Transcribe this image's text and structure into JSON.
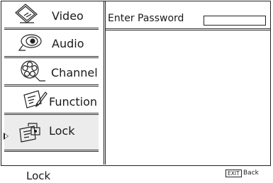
{
  "menu": {
    "items": [
      {
        "label": "Video",
        "icon": "video-icon"
      },
      {
        "label": "Audio",
        "icon": "audio-icon"
      },
      {
        "label": "Channel",
        "icon": "channel-icon"
      },
      {
        "label": "Function",
        "icon": "function-icon"
      },
      {
        "label": "Lock",
        "icon": "lock-icon",
        "selected": true
      }
    ]
  },
  "content": {
    "password_label": "Enter Password",
    "password_value": ""
  },
  "footer": {
    "title": "Lock",
    "exit_key": "EXIT",
    "back_label": "Back"
  }
}
